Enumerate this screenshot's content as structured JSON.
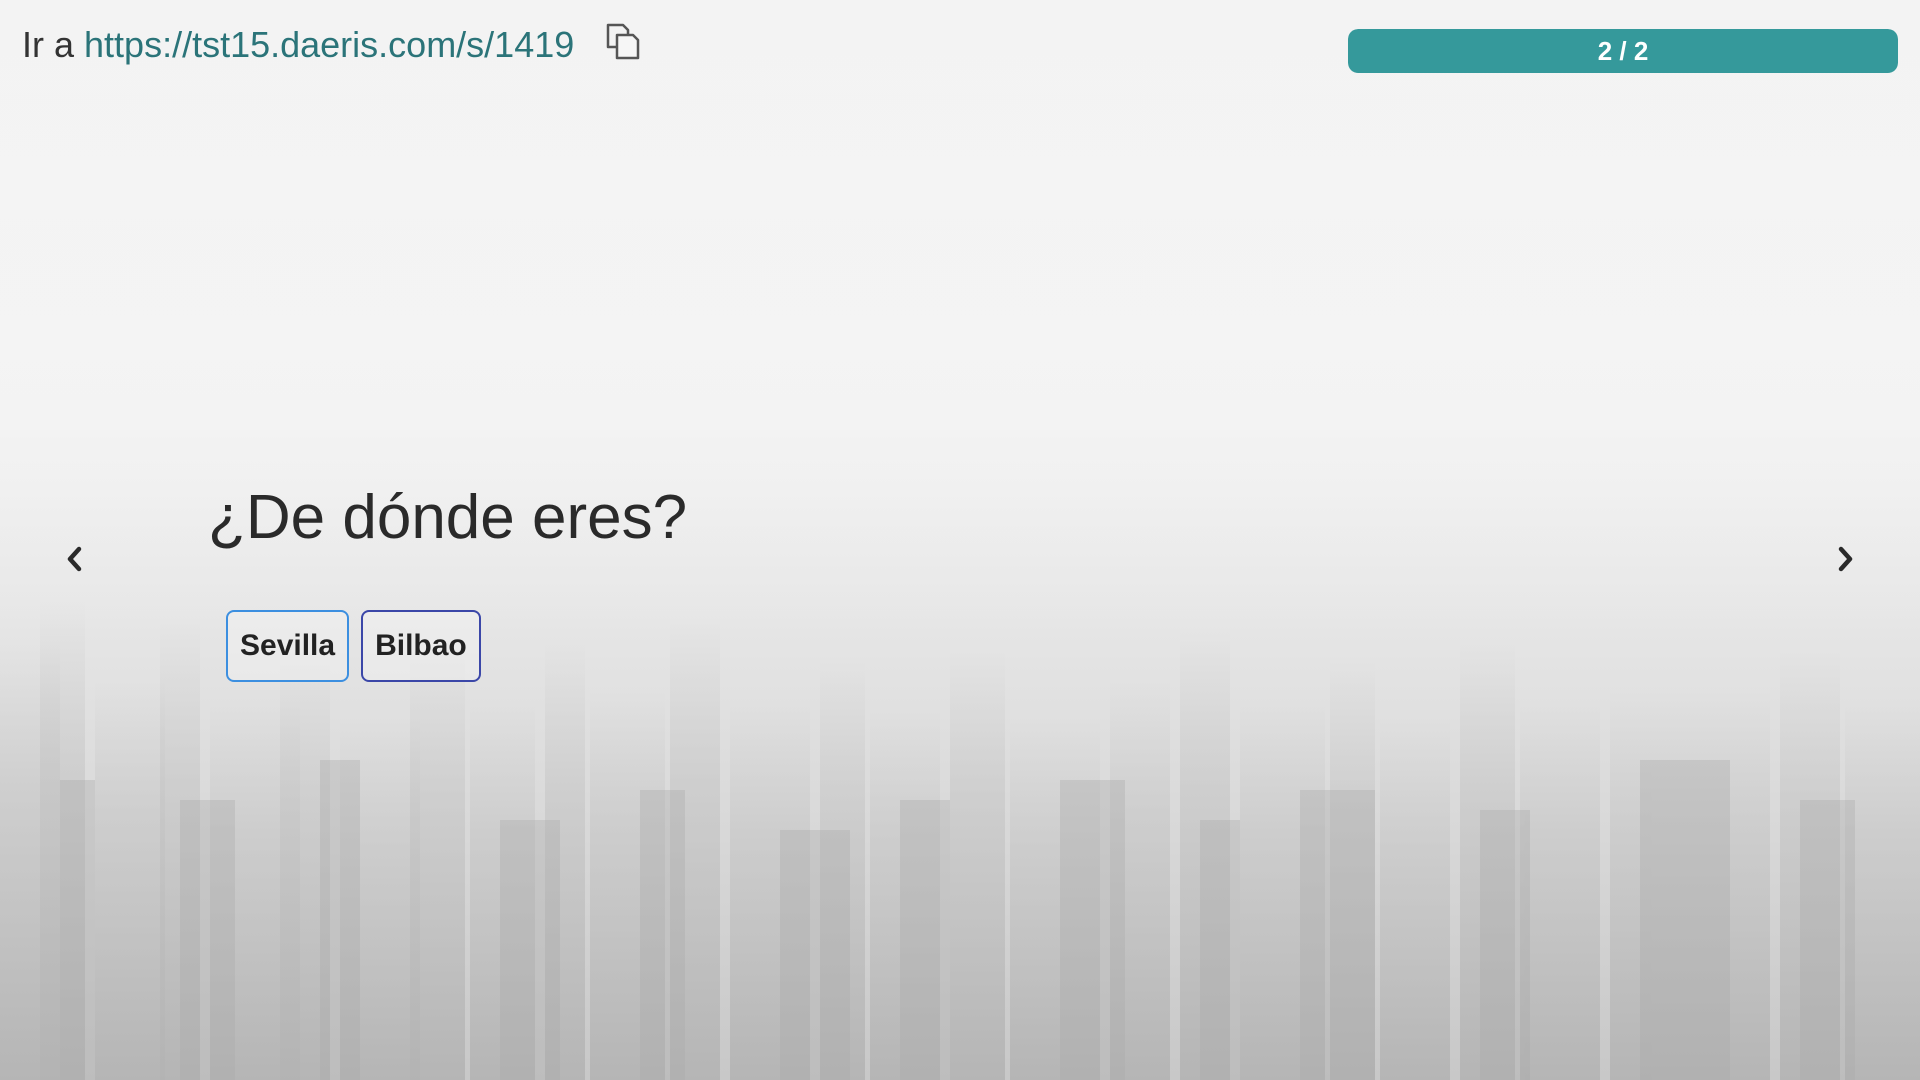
{
  "header": {
    "go_label": "Ir a",
    "share_url": "https://tst15.daeris.com/s/1419",
    "copy_icon": "copy-icon"
  },
  "progress": {
    "text": "2 / 2",
    "current": 2,
    "total": 2,
    "fraction": 1.0,
    "color": "#35999b"
  },
  "navigation": {
    "prev_icon": "chevron-left-icon",
    "next_icon": "chevron-right-icon"
  },
  "question": {
    "text": "¿De dónde eres?",
    "options": [
      {
        "label": "Sevilla",
        "border_color": "#3c8fe0"
      },
      {
        "label": "Bilbao",
        "border_color": "#3b47a8"
      }
    ]
  },
  "background": {
    "description_icon": "city-skyline-background"
  }
}
